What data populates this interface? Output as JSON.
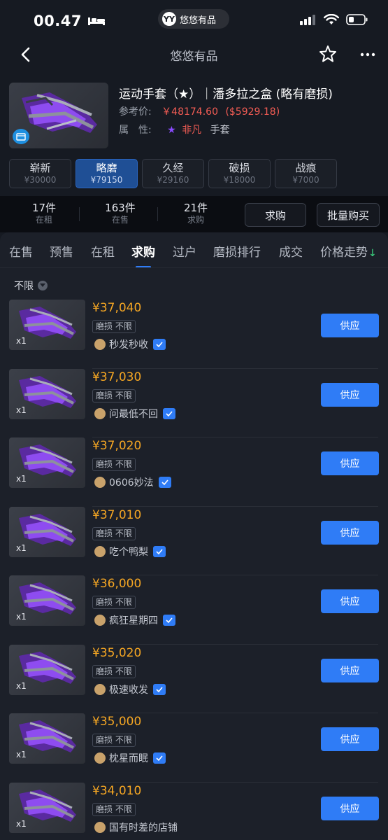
{
  "status_bar": {
    "time": "00.47",
    "island_logo": "YY",
    "island_text": "悠悠有品"
  },
  "nav": {
    "title": "悠悠有品"
  },
  "product": {
    "name": "运动手套（★）｜潘多拉之盒 (略有磨损)",
    "ref_price_label": "参考价:",
    "ref_price": "￥48174.60",
    "ref_price_usd": "($5929.18)",
    "attr_label": "属　性:",
    "rarity_star": "★",
    "rarity": "非凡",
    "type": "手套"
  },
  "wear_tabs": [
    {
      "name": "崭新",
      "price": "¥30000"
    },
    {
      "name": "略磨",
      "price": "¥79150"
    },
    {
      "name": "久经",
      "price": "¥29160"
    },
    {
      "name": "破损",
      "price": "¥18000"
    },
    {
      "name": "战痕",
      "price": "¥7000"
    }
  ],
  "stats": [
    {
      "count": "17件",
      "label": "在租"
    },
    {
      "count": "163件",
      "label": "在售"
    },
    {
      "count": "21件",
      "label": "求购"
    }
  ],
  "actions": {
    "buy_request": "求购",
    "bulk_buy": "批量购买"
  },
  "tabs": [
    "在售",
    "预售",
    "在租",
    "求购",
    "过户",
    "磨损排行",
    "成交",
    "价格走势"
  ],
  "tab_trend_icon": "↓",
  "filter": {
    "label": "不限"
  },
  "orders": [
    {
      "price": "¥37,040",
      "wear": "磨损 不限",
      "seller": "秒发秒收",
      "qty": "x1",
      "action": "供应"
    },
    {
      "price": "¥37,030",
      "wear": "磨损 不限",
      "seller": "问最低不回",
      "qty": "x1",
      "action": "供应"
    },
    {
      "price": "¥37,020",
      "wear": "磨损 不限",
      "seller": "0606妙法",
      "qty": "x1",
      "action": "供应"
    },
    {
      "price": "¥37,010",
      "wear": "磨损 不限",
      "seller": "吃个鸭梨",
      "qty": "x1",
      "action": "供应"
    },
    {
      "price": "¥36,000",
      "wear": "磨损 不限",
      "seller": "疯狂星期四",
      "qty": "x1",
      "action": "供应"
    },
    {
      "price": "¥35,020",
      "wear": "磨损 不限",
      "seller": "极速收发",
      "qty": "x1",
      "action": "供应"
    },
    {
      "price": "¥35,000",
      "wear": "磨损 不限",
      "seller": "枕星而眠",
      "qty": "x1",
      "action": "供应"
    },
    {
      "price": "¥34,010",
      "wear": "磨损 不限",
      "seller": "国有时差的店铺",
      "qty": "x1",
      "action": "供应"
    }
  ],
  "colors": {
    "accent_blue": "#2f7cf6",
    "price_orange": "#f5a623",
    "price_red": "#f25c54",
    "rarity_purple": "#8a4bff",
    "trend_green": "#3ddc84"
  }
}
